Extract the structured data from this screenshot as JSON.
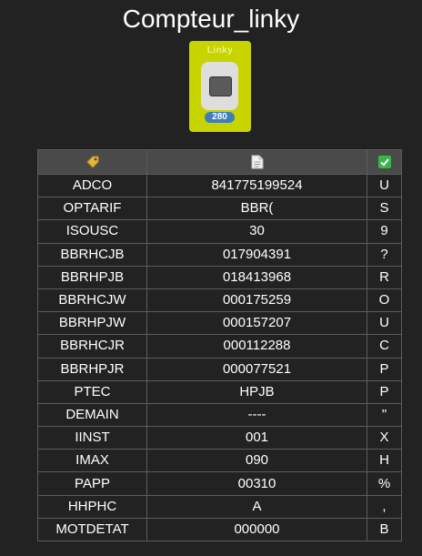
{
  "page": {
    "title": "Compteur_linky"
  },
  "device": {
    "brand": "Linky",
    "badge": "280"
  },
  "table": {
    "header_icons": [
      "tag-icon",
      "document-icon",
      "checkbox-checked-icon"
    ],
    "rows": [
      {
        "label": "ADCO",
        "value": "841775199524",
        "check": "U"
      },
      {
        "label": "OPTARIF",
        "value": "BBR(",
        "check": "S"
      },
      {
        "label": "ISOUSC",
        "value": "30",
        "check": "9"
      },
      {
        "label": "BBRHCJB",
        "value": "017904391",
        "check": "?"
      },
      {
        "label": "BBRHPJB",
        "value": "018413968",
        "check": "R"
      },
      {
        "label": "BBRHCJW",
        "value": "000175259",
        "check": "O"
      },
      {
        "label": "BBRHPJW",
        "value": "000157207",
        "check": "U"
      },
      {
        "label": "BBRHCJR",
        "value": "000112288",
        "check": "C"
      },
      {
        "label": "BBRHPJR",
        "value": "000077521",
        "check": "P"
      },
      {
        "label": "PTEC",
        "value": "HPJB",
        "check": "P"
      },
      {
        "label": "DEMAIN",
        "value": "----",
        "check": "\""
      },
      {
        "label": "IINST",
        "value": "001",
        "check": "X"
      },
      {
        "label": "IMAX",
        "value": "090",
        "check": "H"
      },
      {
        "label": "PAPP",
        "value": "00310",
        "check": "%"
      },
      {
        "label": "HHPHC",
        "value": "A",
        "check": ","
      },
      {
        "label": "MOTDETAT",
        "value": "000000",
        "check": "B"
      }
    ]
  }
}
